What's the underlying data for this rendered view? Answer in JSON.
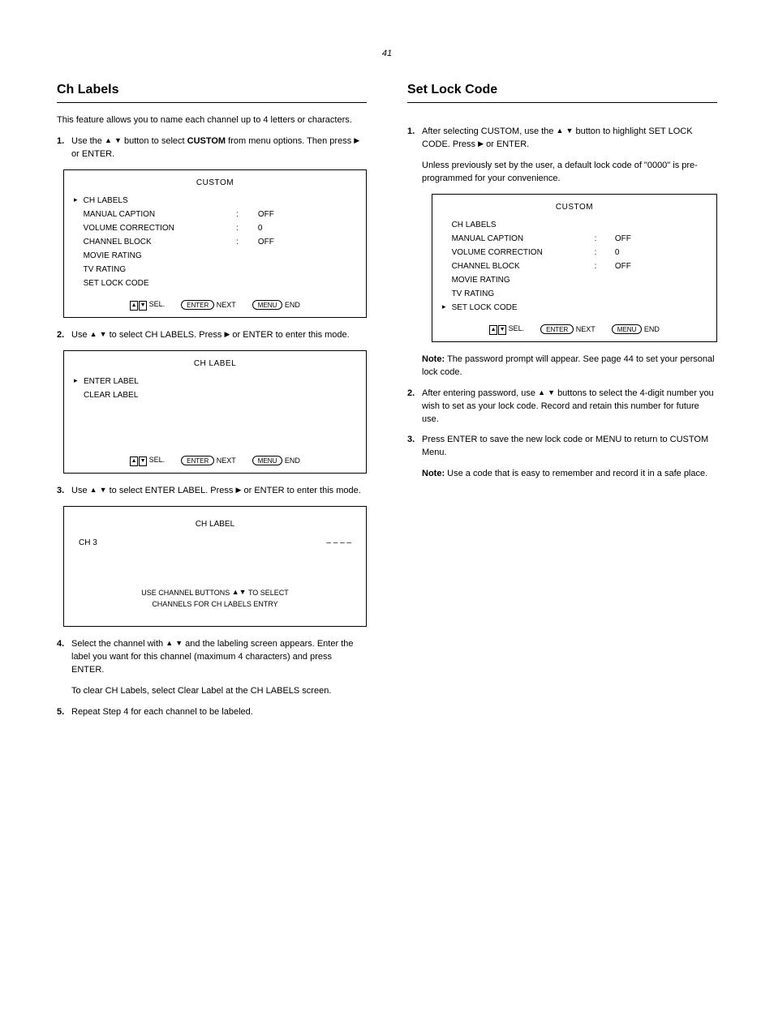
{
  "page_number": "41",
  "left": {
    "heading": "Ch Labels",
    "intro": "This feature allows you to name each channel up to 4 letters or characters.",
    "step1_prefix": "Use the",
    "step1_mid": "button to select",
    "step1_target": "CUSTOM",
    "step1_suffix": "from menu options. Then press",
    "step1_tail": "or",
    "step1_end": ".",
    "menu1": {
      "title": "CUSTOM",
      "rows": [
        {
          "cursor": "▸",
          "label": "CH LABELS",
          "space": "",
          "val": ""
        },
        {
          "cursor": "",
          "label": "MANUAL CAPTION",
          "space": ":",
          "val": "OFF"
        },
        {
          "cursor": "",
          "label": "VOLUME CORRECTION",
          "space": ":",
          "val": "  0"
        },
        {
          "cursor": "",
          "label": "CHANNEL BLOCK",
          "space": ":",
          "val": "OFF"
        },
        {
          "cursor": "",
          "label": "MOVIE RATING",
          "space": "",
          "val": ""
        },
        {
          "cursor": "",
          "label": "TV RATING",
          "space": "",
          "val": ""
        },
        {
          "cursor": "",
          "label": "SET LOCK CODE",
          "space": "",
          "val": ""
        }
      ],
      "bottom_left": "SEL.",
      "bottom_mid": "NEXT",
      "bottom_right": "END"
    },
    "step2_prefix": "Use",
    "step2_suffix": "to select CH LABELS. Press",
    "step2_or": "or",
    "step2_end": "to enter this mode.",
    "menu2": {
      "title": "CH LABEL",
      "rows": [
        {
          "cursor": "▸",
          "label": "ENTER LABEL",
          "space": "",
          "val": ""
        },
        {
          "cursor": "",
          "label": "CLEAR LABEL",
          "space": "",
          "val": ""
        }
      ],
      "bottom_left": "SEL.",
      "bottom_mid": "NEXT",
      "bottom_right": "END"
    },
    "step3_prefix": "Use",
    "step3_mid": "to select ENTER LABEL. Press",
    "step3_or": "or",
    "step3_tail": "to enter this mode.",
    "edit": {
      "title": "CH LABEL",
      "ch": "CH   3",
      "label": "– – – –",
      "bottom_line1_a": "USE CHANNEL BUTTONS",
      "bottom_line1_b": "TO SELECT",
      "bottom_line2": "CHANNELS FOR CH LABELS ENTRY"
    },
    "step4_prefix": "Select the channel with",
    "step4_tail": "and the labeling screen appears. Enter the label you want for this channel (maximum 4 characters) and press ENTER.",
    "p_clear": "To clear CH Labels, select Clear Label at the CH LABELS screen.",
    "step5": "Repeat Step 4 for each channel to be labeled."
  },
  "right": {
    "heading": "Set Lock Code",
    "step1_a": "After selecting CUSTOM, use the",
    "step1_b": "button to highlight SET LOCK CODE. Press",
    "step1_c": "or ENTER.",
    "p1": "Unless previously set by the user, a default lock code of \"0000\" is pre-programmed for your convenience.",
    "lock": {
      "title": "CUSTOM",
      "rows": [
        {
          "cursor": "",
          "label": "CH LABELS",
          "space": "",
          "val": ""
        },
        {
          "cursor": "",
          "label": "MANUAL CAPTION",
          "space": ":",
          "val": "OFF"
        },
        {
          "cursor": "",
          "label": "VOLUME CORRECTION",
          "space": ":",
          "val": "  0"
        },
        {
          "cursor": "",
          "label": "CHANNEL BLOCK",
          "space": ":",
          "val": "OFF"
        },
        {
          "cursor": "",
          "label": "MOVIE RATING",
          "space": "",
          "val": ""
        },
        {
          "cursor": "",
          "label": "TV RATING",
          "space": "",
          "val": ""
        },
        {
          "cursor": "▸",
          "label": "SET LOCK CODE",
          "space": "",
          "val": ""
        }
      ],
      "bottom_left": "SEL.",
      "bottom_mid": "NEXT",
      "bottom_right": "END"
    },
    "note_label": "Note:",
    "note_body": "The password prompt will appear. See page 44 to set your personal lock code.",
    "step2_a": "After entering password, use",
    "step2_b": "buttons to select the 4-digit number you wish to set as your lock code. Record and retain this number for future use.",
    "step3": "Press ENTER to save the new lock code or MENU to return to CUSTOM Menu.",
    "note2_label": "Note:",
    "note2_body": "Use a code that is easy to remember and record it in a safe place."
  }
}
